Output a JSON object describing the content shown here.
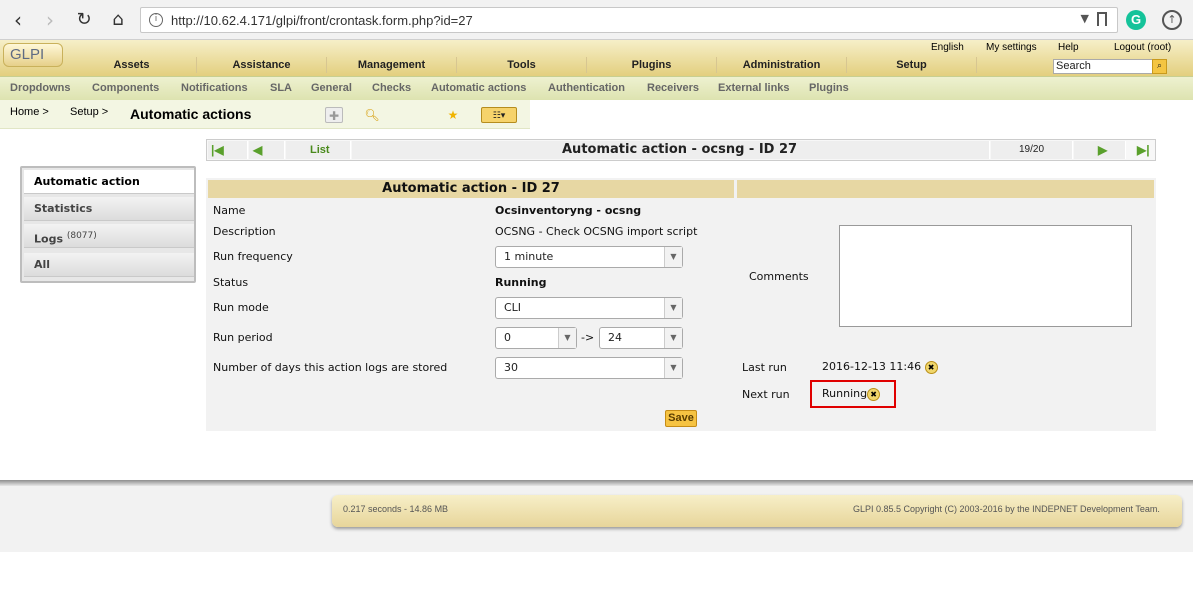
{
  "browser": {
    "url": "http://10.62.4.171/glpi/front/crontask.form.php?id=27",
    "back_icon": "chevron-left-icon",
    "forward_icon": "chevron-right-icon",
    "reload_icon": "reload-icon",
    "home_icon": "home-icon",
    "extension_g_label": "G"
  },
  "header": {
    "logo_text": "GLPI",
    "toplinks": [
      "English",
      "My settings",
      "Help",
      "Logout (root)"
    ],
    "main_menu": [
      "Assets",
      "Assistance",
      "Management",
      "Tools",
      "Plugins",
      "Administration",
      "Setup"
    ],
    "search_placeholder": "Search"
  },
  "submenu": [
    "Dropdowns",
    "Components",
    "Notifications",
    "SLA",
    "General",
    "Checks",
    "Automatic actions",
    "Authentication",
    "Receivers",
    "External links",
    "Plugins"
  ],
  "breadcrumb": {
    "home": "Home >",
    "setup": "Setup >",
    "title": "Automatic actions"
  },
  "tabs": [
    {
      "label": "Automatic action",
      "count": ""
    },
    {
      "label": "Statistics",
      "count": ""
    },
    {
      "label": "Logs",
      "count": "(8077)"
    },
    {
      "label": "All",
      "count": ""
    }
  ],
  "pager": {
    "list_label": "List",
    "title": "Automatic action - ocsng - ID 27",
    "position": "19/20"
  },
  "form": {
    "header": "Automatic action - ID 27",
    "name_label": "Name",
    "name_value": "Ocsinventoryng - ocsng",
    "description_label": "Description",
    "description_value": "OCSNG - Check OCSNG import script",
    "frequency_label": "Run frequency",
    "frequency_value": "1 minute",
    "status_label": "Status",
    "status_value": "Running",
    "mode_label": "Run mode",
    "mode_value": "CLI",
    "period_label": "Run period",
    "period_from": "0",
    "period_sep": "->",
    "period_to": "24",
    "logs_days_label": "Number of days this action logs are stored",
    "logs_days_value": "30",
    "comments_label": "Comments",
    "last_run_label": "Last run",
    "last_run_value": "2016-12-13 11:46",
    "next_run_label": "Next run",
    "next_run_value": "Running",
    "save_label": "Save"
  },
  "footer": {
    "timing": "0.217 seconds - 14.86 MB",
    "copyright": "GLPI 0.85.5 Copyright (C) 2003-2016 by the INDEPNET Development Team."
  }
}
